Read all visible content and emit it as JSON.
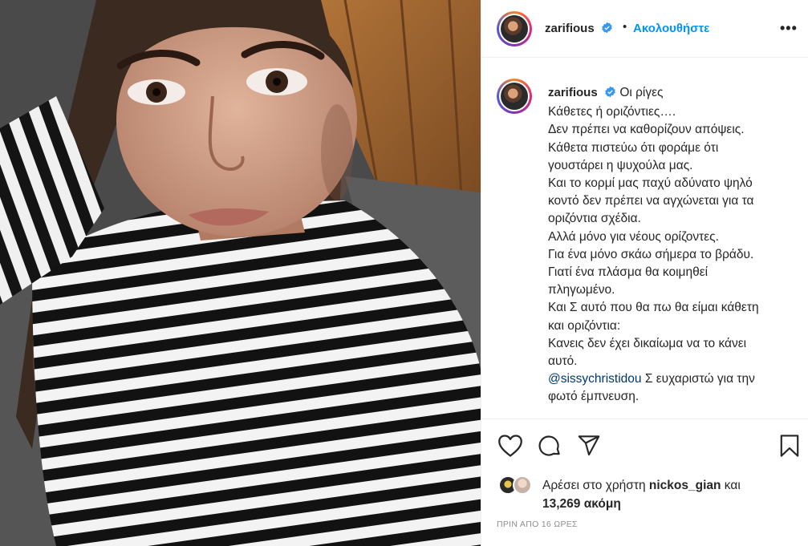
{
  "post": {
    "username": "zarifious",
    "follow_label": "Ακολουθήστε",
    "separator": "•",
    "more_label": "•••"
  },
  "caption": {
    "username": "zarifious",
    "first_text": "Οι ρίγες",
    "lines": [
      "Κάθετες ή οριζόντιες….",
      "Δεν πρέπει να καθορίζουν απόψεις.",
      "Κάθετα πιστεύω ότι φοράμε ότι",
      "γουστάρει η ψυχούλα μας.",
      "Και το κορμί μας παχύ αδύνατο ψηλό",
      "κοντό δεν πρέπει να αγχώνεται για τα",
      "οριζόντια σχέδια.",
      "Αλλά μόνο για νέους ορίζοντες.",
      "Για ένα μόνο σκάω σήμερα το βράδυ.",
      "Γιατί ένα πλάσμα θα κοιμηθεί",
      "πληγωμένο.",
      "Και Σ αυτό που θα πω θα είμαι κάθετη",
      "και οριζόντια:",
      "Κανεις δεν έχει δικαίωμα να το κάνει",
      "αυτό."
    ],
    "mention": "@sissychristidou",
    "mention_rest": " Σ ευχαριστώ για την",
    "last_line": "φωτό έμπνευση."
  },
  "likes": {
    "prefix": "Αρέσει στο χρήστη ",
    "user": "nickos_gian",
    "and": " και",
    "count": "13,269 ακόμη"
  },
  "timestamp": "ΠΡΙΝ ΑΠΟ 16 ΩΡΕΣ",
  "icons": {
    "like": "heart-icon",
    "comment": "comment-icon",
    "share": "share-icon",
    "save": "bookmark-icon",
    "verified": "verified-badge-icon"
  },
  "colors": {
    "accent": "#0095f6",
    "verified": "#3897f0",
    "mention": "#00376b",
    "muted": "#8e8e8e"
  }
}
